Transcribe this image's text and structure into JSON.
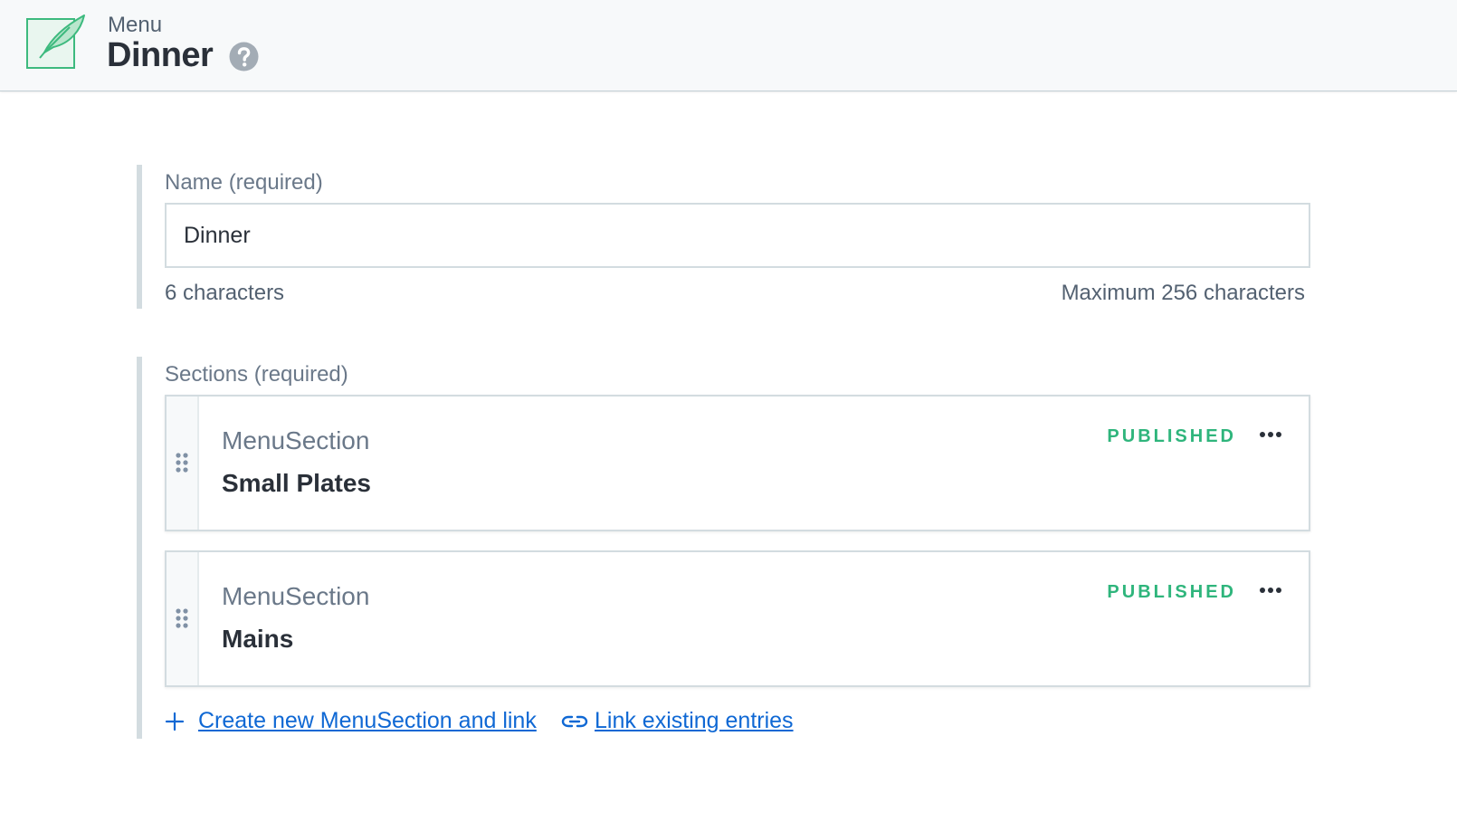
{
  "header": {
    "eyebrow": "Menu",
    "title": "Dinner",
    "icon": "feather-icon",
    "help_icon": "help-icon"
  },
  "name_field": {
    "label": "Name (required)",
    "value": "Dinner",
    "char_count": "6 characters",
    "char_max": "Maximum 256 characters"
  },
  "sections_field": {
    "label": "Sections (required)",
    "entries": [
      {
        "type": "MenuSection",
        "title": "Small Plates",
        "status": "PUBLISHED"
      },
      {
        "type": "MenuSection",
        "title": "Mains",
        "status": "PUBLISHED"
      }
    ],
    "create_link": "Create new MenuSection and link",
    "existing_link": "Link existing entries"
  },
  "colors": {
    "accent_link": "#0f68d4",
    "status_published": "#2fb57c",
    "brand_icon": "#3dba7e"
  }
}
